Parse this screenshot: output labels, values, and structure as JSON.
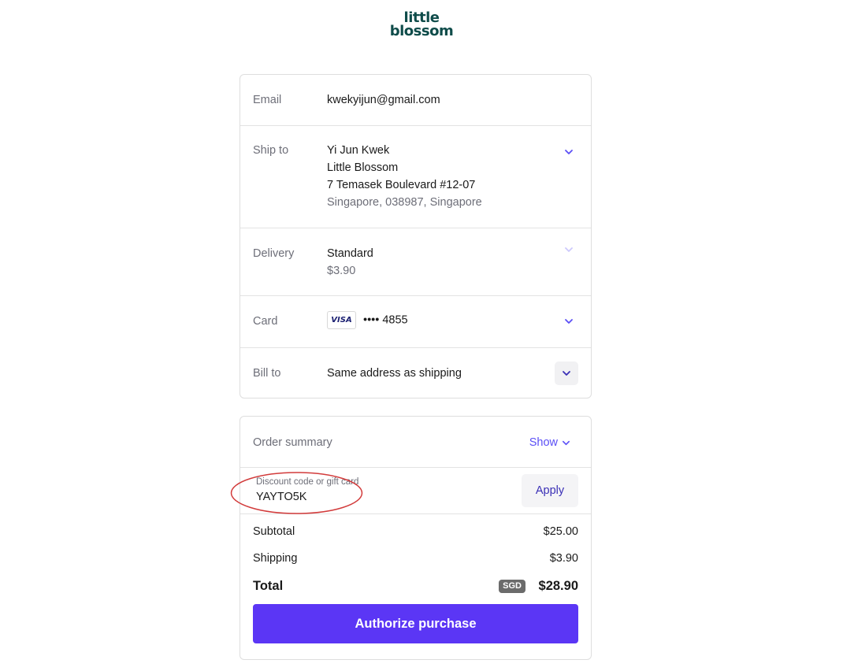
{
  "brand": {
    "line1": "little",
    "line2": "blossom",
    "color": "#0f4c4a"
  },
  "contact": {
    "label": "Email",
    "value": "kwekyijun@gmail.com"
  },
  "shipping": {
    "label": "Ship to",
    "name": "Yi Jun Kwek",
    "company": "Little Blossom",
    "street": "7 Temasek Boulevard #12-07",
    "city_line": "Singapore, 038987, Singapore"
  },
  "delivery": {
    "label": "Delivery",
    "method": "Standard",
    "price": "$3.90"
  },
  "card": {
    "label": "Card",
    "brand": "VISA",
    "number": "•••• 4855"
  },
  "billing": {
    "label": "Bill to",
    "value": "Same address as shipping"
  },
  "summary": {
    "title": "Order summary",
    "toggle_label": "Show",
    "discount_placeholder": "Discount code or gift card",
    "discount_value": "YAYTO5K",
    "apply_label": "Apply",
    "subtotal_label": "Subtotal",
    "subtotal_value": "$25.00",
    "shipping_label": "Shipping",
    "shipping_value": "$3.90",
    "total_label": "Total",
    "currency": "SGD",
    "total_value": "$28.90"
  },
  "cta": {
    "label": "Authorize purchase",
    "color": "#5b36f5"
  },
  "accent_color": "#5b4ff6",
  "annotation_color": "#d23b3b"
}
